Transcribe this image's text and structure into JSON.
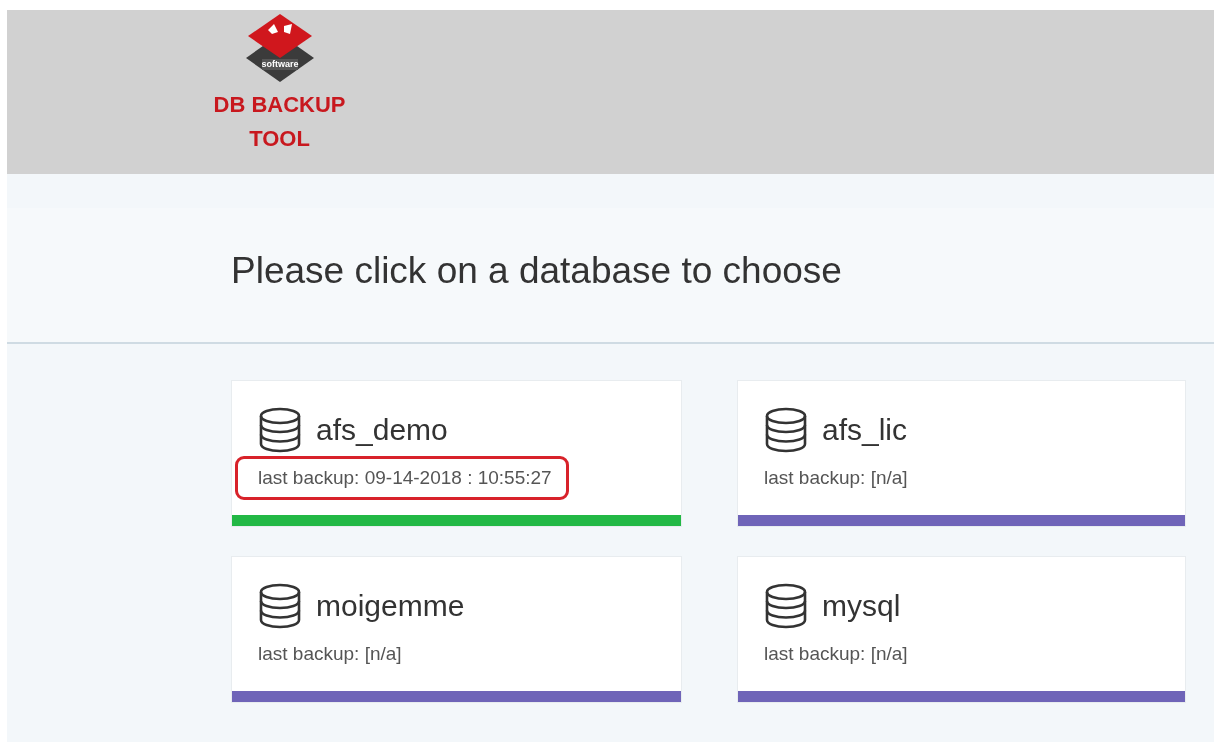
{
  "header": {
    "logo_text": "software",
    "title_line_1": "DB BACKUP",
    "title_line_2": "TOOL"
  },
  "heading": "Please click on a database to choose",
  "databases": [
    {
      "name": "afs_demo",
      "last_backup": "last backup: 09-14-2018 : 10:55:27",
      "color": "#22b845",
      "highlighted": true
    },
    {
      "name": "afs_lic",
      "last_backup": "last backup: [n/a]",
      "color": "#6f64b8",
      "highlighted": false
    },
    {
      "name": "moigemme",
      "last_backup": "last backup: [n/a]",
      "color": "#6f64b8",
      "highlighted": false
    },
    {
      "name": "mysql",
      "last_backup": "last backup: [n/a]",
      "color": "#6f64b8",
      "highlighted": false
    }
  ]
}
